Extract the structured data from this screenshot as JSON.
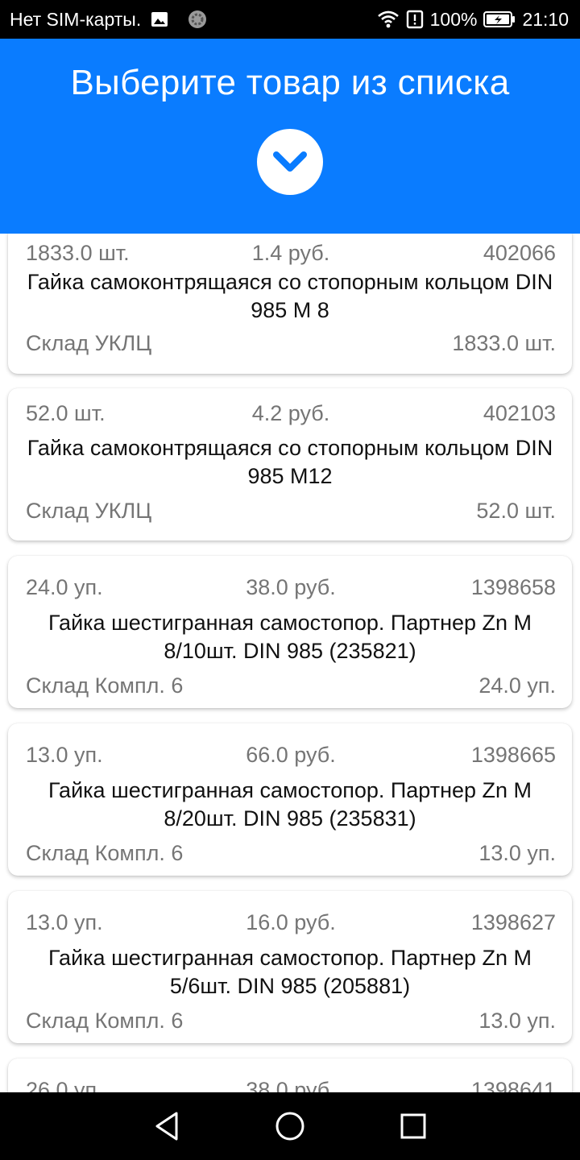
{
  "status_bar": {
    "carrier": "Нет SIM-карты.",
    "battery": "100%",
    "time": "21:10",
    "icons": [
      "image-icon",
      "sync-icon",
      "wifi-icon",
      "alert-icon",
      "battery-charging-icon"
    ]
  },
  "header": {
    "title": "Выберите товар из списка",
    "toggle_icon": "chevron-down-icon",
    "background_color": "#0a7cff"
  },
  "items": [
    {
      "quantity": "1833.0 шт.",
      "price": "1.4 руб.",
      "code": "402066",
      "name": "Гайка самоконтрящаяся со стопорным кольцом DIN 985 M 8",
      "warehouse": "Склад УКЛЦ",
      "stock": "1833.0 шт."
    },
    {
      "quantity": "52.0 шт.",
      "price": "4.2 руб.",
      "code": "402103",
      "name": "Гайка самоконтрящаяся со стопорным кольцом DIN 985 M12",
      "warehouse": "Склад УКЛЦ",
      "stock": "52.0 шт."
    },
    {
      "quantity": "24.0 уп.",
      "price": "38.0 руб.",
      "code": "1398658",
      "name": "Гайка шестигранная самостопор. Партнер Zn М 8/10шт. DIN 985 (235821)",
      "warehouse": "Склад Компл. 6",
      "stock": "24.0 уп."
    },
    {
      "quantity": "13.0 уп.",
      "price": "66.0 руб.",
      "code": "1398665",
      "name": "Гайка шестигранная самостопор. Партнер Zn М 8/20шт. DIN 985 (235831)",
      "warehouse": "Склад Компл. 6",
      "stock": "13.0 уп."
    },
    {
      "quantity": "13.0 уп.",
      "price": "16.0 руб.",
      "code": "1398627",
      "name": "Гайка шестигранная самостопор. Партнер Zn М 5/6шт. DIN 985 (205881)",
      "warehouse": "Склад Компл. 6",
      "stock": "13.0 уп."
    },
    {
      "quantity": "26.0 уп.",
      "price": "38.0 руб.",
      "code": "1398641",
      "name": "",
      "warehouse": "",
      "stock": ""
    }
  ],
  "nav_bar": {
    "icons": [
      "back-icon",
      "home-icon",
      "recents-icon"
    ]
  }
}
